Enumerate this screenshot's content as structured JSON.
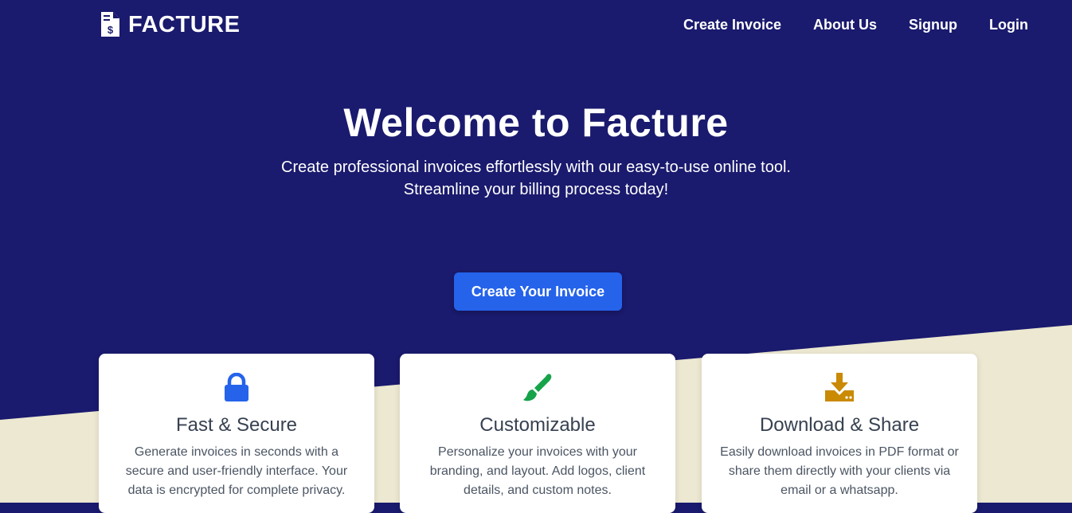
{
  "brand": {
    "name": "FACTURE",
    "logo_icon": "invoice-dollar-icon"
  },
  "nav": [
    {
      "label": "Create Invoice"
    },
    {
      "label": "About Us"
    },
    {
      "label": "Signup"
    },
    {
      "label": "Login"
    }
  ],
  "hero": {
    "title": "Welcome to Facture",
    "subtitle_line1": "Create professional invoices effortlessly with our easy-to-use online tool.",
    "subtitle_line2": "Streamline your billing process today!",
    "cta_label": "Create Your Invoice"
  },
  "features": [
    {
      "icon": "lock-icon",
      "title": "Fast & Secure",
      "text": "Generate invoices in seconds with a secure and user-friendly interface. Your data is encrypted for complete privacy."
    },
    {
      "icon": "paintbrush-icon",
      "title": "Customizable",
      "text": "Personalize your invoices with your branding, and layout. Add logos, client details, and custom notes."
    },
    {
      "icon": "download-icon",
      "title": "Download & Share",
      "text": "Easily download invoices in PDF format or share them directly with your clients via email or a whatsapp."
    }
  ],
  "colors": {
    "hero_bg": "#1a1a6e",
    "lower_bg": "#ece8d1",
    "cta": "#2563eb",
    "lock": "#2563eb",
    "brush": "#16a34a",
    "download": "#ca8a04"
  }
}
